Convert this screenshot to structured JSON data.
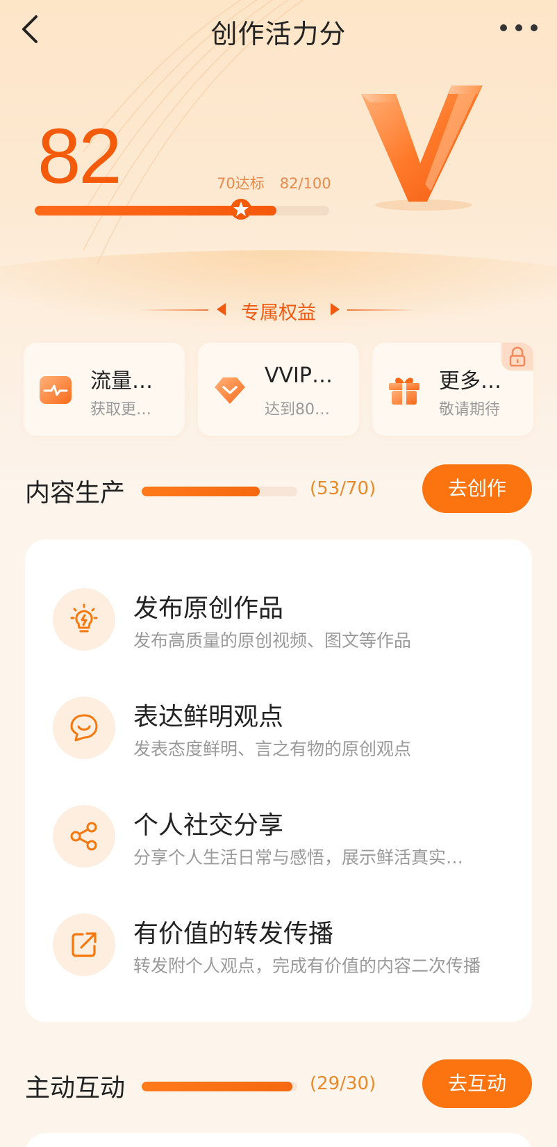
{
  "header": {
    "title": "创作活力分"
  },
  "score": {
    "value": "82",
    "threshold_label": "70达标",
    "progress_label": "82/100",
    "progress_fraction": 0.82,
    "star_fraction": 0.7
  },
  "benefits": {
    "title": "专属权益",
    "items": [
      {
        "name": "流量…",
        "desc": "获取更…",
        "icon": "traffic-pulse-icon",
        "locked": false
      },
      {
        "name": "VVIP…",
        "desc": "达到80…",
        "icon": "diamond-icon",
        "locked": false
      },
      {
        "name": "更多…",
        "desc": "敬请期待",
        "icon": "gift-icon",
        "locked": true
      }
    ]
  },
  "content_production": {
    "title": "内容生产",
    "count": "(53/70)",
    "progress_fraction": 0.757,
    "button": "去创作",
    "tasks": [
      {
        "name": "发布原创作品",
        "desc": "发布高质量的原创视频、图文等作品",
        "icon": "lightbulb-icon"
      },
      {
        "name": "表达鲜明观点",
        "desc": "发表态度鲜明、言之有物的原创观点",
        "icon": "smile-chat-icon"
      },
      {
        "name": "个人社交分享",
        "desc": "分享个人生活日常与感悟，展示鲜活真实…",
        "icon": "share-icon"
      },
      {
        "name": "有价值的转发传播",
        "desc": "转发附个人观点，完成有价值的内容二次传播",
        "icon": "forward-icon"
      }
    ]
  },
  "active_interaction": {
    "title": "主动互动",
    "count": "(29/30)",
    "progress_fraction": 0.967,
    "button": "去互动"
  },
  "colors": {
    "accent": "#f35a0a",
    "button": "#fb7410",
    "hero_bg": "#fde5c8",
    "page_bg": "#fdf5ec"
  }
}
